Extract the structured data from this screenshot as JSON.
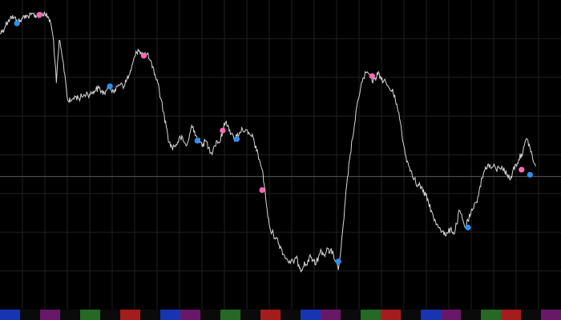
{
  "chart_data": {
    "type": "line",
    "series": [
      {
        "values": [
          0.84,
          0.86,
          0.89,
          0.92,
          0.94,
          0.93,
          0.92,
          0.91,
          0.93,
          0.95,
          0.94,
          0.95,
          0.96,
          0.94,
          0.95,
          0.96,
          0.95,
          0.94,
          0.9,
          0.8,
          0.55,
          0.8,
          0.71,
          0.6,
          0.45,
          0.44,
          0.46,
          0.47,
          0.46,
          0.47,
          0.48,
          0.49,
          0.48,
          0.5,
          0.51,
          0.52,
          0.5,
          0.49,
          0.51,
          0.53,
          0.51,
          0.5,
          0.54,
          0.55,
          0.53,
          0.57,
          0.6,
          0.66,
          0.71,
          0.75,
          0.73,
          0.71,
          0.72,
          0.69,
          0.64,
          0.6,
          0.55,
          0.46,
          0.38,
          0.29,
          0.2,
          0.17,
          0.18,
          0.2,
          0.23,
          0.21,
          0.18,
          0.22,
          0.3,
          0.27,
          0.22,
          0.2,
          0.19,
          0.21,
          0.17,
          0.14,
          0.18,
          0.21,
          0.2,
          0.27,
          0.32,
          0.3,
          0.25,
          0.22,
          0.24,
          0.26,
          0.28,
          0.27,
          0.25,
          0.24,
          0.22,
          0.15,
          0.1,
          0.04,
          -0.08,
          -0.24,
          -0.32,
          -0.34,
          -0.36,
          -0.4,
          -0.43,
          -0.47,
          -0.49,
          -0.51,
          -0.5,
          -0.48,
          -0.52,
          -0.55,
          -0.5,
          -0.52,
          -0.46,
          -0.49,
          -0.52,
          -0.47,
          -0.44,
          -0.46,
          -0.42,
          -0.45,
          -0.44,
          -0.5,
          -0.55,
          -0.42,
          -0.25,
          -0.05,
          0.1,
          0.22,
          0.33,
          0.45,
          0.53,
          0.58,
          0.61,
          0.6,
          0.56,
          0.58,
          0.6,
          0.59,
          0.56,
          0.55,
          0.52,
          0.5,
          0.48,
          0.4,
          0.32,
          0.2,
          0.12,
          0.06,
          0.03,
          -0.01,
          -0.06,
          -0.05,
          -0.09,
          -0.11,
          -0.15,
          -0.2,
          -0.26,
          -0.28,
          -0.3,
          -0.32,
          -0.35,
          -0.33,
          -0.3,
          -0.34,
          -0.28,
          -0.2,
          -0.25,
          -0.3,
          -0.26,
          -0.22,
          -0.19,
          -0.15,
          -0.08,
          -0.01,
          0.04,
          0.07,
          0.05,
          0.06,
          0.04,
          0.05,
          0.06,
          0.03,
          0.01,
          -0.02,
          0.04,
          0.07,
          0.1,
          0.13,
          0.18,
          0.22,
          0.17,
          0.1,
          0.06
        ]
      }
    ],
    "markers_pink": [
      {
        "i": 14,
        "v": 0.95
      },
      {
        "i": 51,
        "v": 0.71
      },
      {
        "i": 79,
        "v": 0.27
      },
      {
        "i": 93,
        "v": -0.08
      },
      {
        "i": 132,
        "v": 0.59
      },
      {
        "i": 185,
        "v": 0.04
      }
    ],
    "markers_blue": [
      {
        "i": 6,
        "v": 0.9
      },
      {
        "i": 39,
        "v": 0.53
      },
      {
        "i": 70,
        "v": 0.21
      },
      {
        "i": 84,
        "v": 0.22
      },
      {
        "i": 120,
        "v": -0.5
      },
      {
        "i": 166,
        "v": -0.3
      },
      {
        "i": 188,
        "v": 0.01
      }
    ],
    "ylim": [
      -0.75,
      1.0
    ],
    "xlim": [
      0,
      199
    ],
    "hline": 0,
    "grid": true,
    "colors": {
      "background": "#000000",
      "line": "#d8d8d8",
      "grid": "#1f1f1f",
      "hline": "#5a5a5a",
      "pink_marker": "#ff69b4",
      "blue_marker": "#2f8ff0"
    }
  },
  "time_strip": {
    "segment_colors": [
      "#1a3ccf",
      "#0a0a0a",
      "#7a1a7a",
      "#0a0a0a",
      "#2a7a2a",
      "#0a0a0a",
      "#c02020",
      "#0a0a0a",
      "#1a3ccf",
      "#7a1a7a",
      "#0a0a0a",
      "#2a7a2a",
      "#0a0a0a",
      "#c02020",
      "#0a0a0a",
      "#1a3ccf",
      "#7a1a7a",
      "#0a0a0a",
      "#2a7a2a",
      "#c02020",
      "#0a0a0a",
      "#1a3ccf",
      "#7a1a7a",
      "#0a0a0a",
      "#2a7a2a",
      "#c02020",
      "#0a0a0a",
      "#7a1a7a"
    ]
  }
}
